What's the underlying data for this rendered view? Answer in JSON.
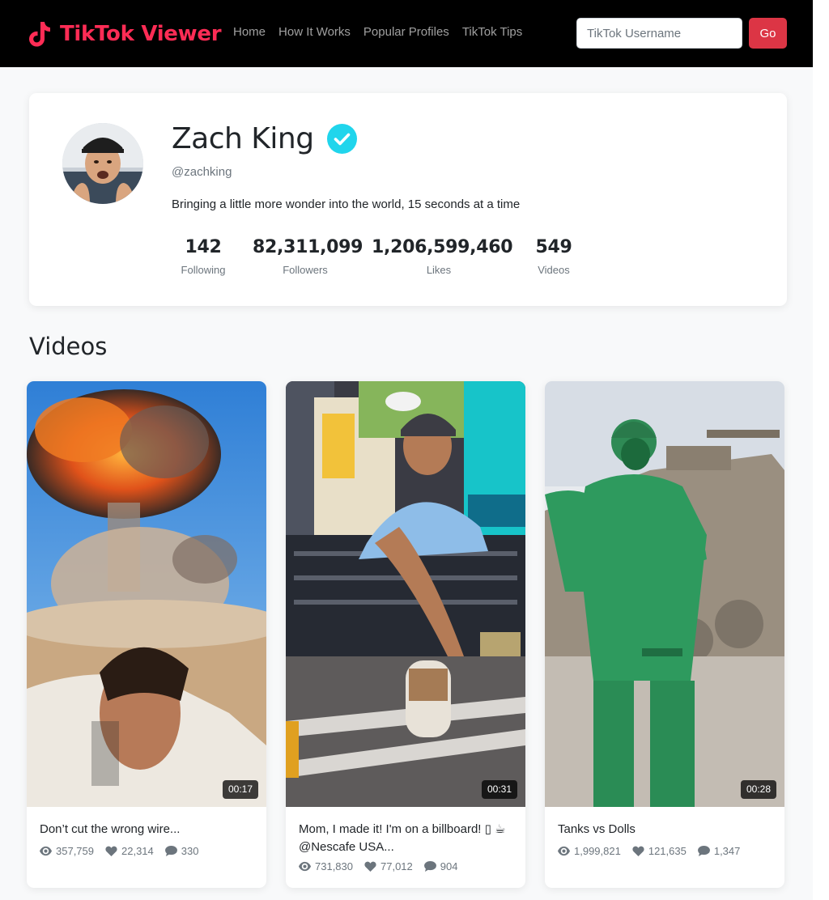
{
  "navbar": {
    "brand": "TikTok Viewer",
    "links": [
      "Home",
      "How It Works",
      "Popular Profiles",
      "TikTok Tips"
    ],
    "search_placeholder": "TikTok Username",
    "go_label": "Go"
  },
  "profile": {
    "name": "Zach King",
    "handle": "@zachking",
    "bio": "Bringing a little more wonder into the world, 15 seconds at a time",
    "verified": true,
    "stats": [
      {
        "value": "142",
        "label": "Following"
      },
      {
        "value": "82,311,099",
        "label": "Followers"
      },
      {
        "value": "1,206,599,460",
        "label": "Likes"
      },
      {
        "value": "549",
        "label": "Videos"
      }
    ]
  },
  "videos_heading": "Videos",
  "videos": [
    {
      "title": "Don’t cut the wrong wire...",
      "duration": "00:17",
      "views": "357,759",
      "likes": "22,314",
      "comments": "330"
    },
    {
      "title": "Mom, I made it! I'm on a billboard! ▯ ☕ @Nescafe USA...",
      "duration": "00:31",
      "views": "731,830",
      "likes": "77,012",
      "comments": "904"
    },
    {
      "title": "Tanks vs Dolls",
      "duration": "00:28",
      "views": "1,999,821",
      "likes": "121,635",
      "comments": "1,347"
    }
  ],
  "colors": {
    "brand": "#fe2c55",
    "go_button": "#dc3545",
    "verified": "#20d5ec",
    "navbar": "#000000"
  },
  "icons": [
    "tiktok-logo-icon",
    "verified-check-icon",
    "eye-icon",
    "heart-icon",
    "comment-icon"
  ]
}
